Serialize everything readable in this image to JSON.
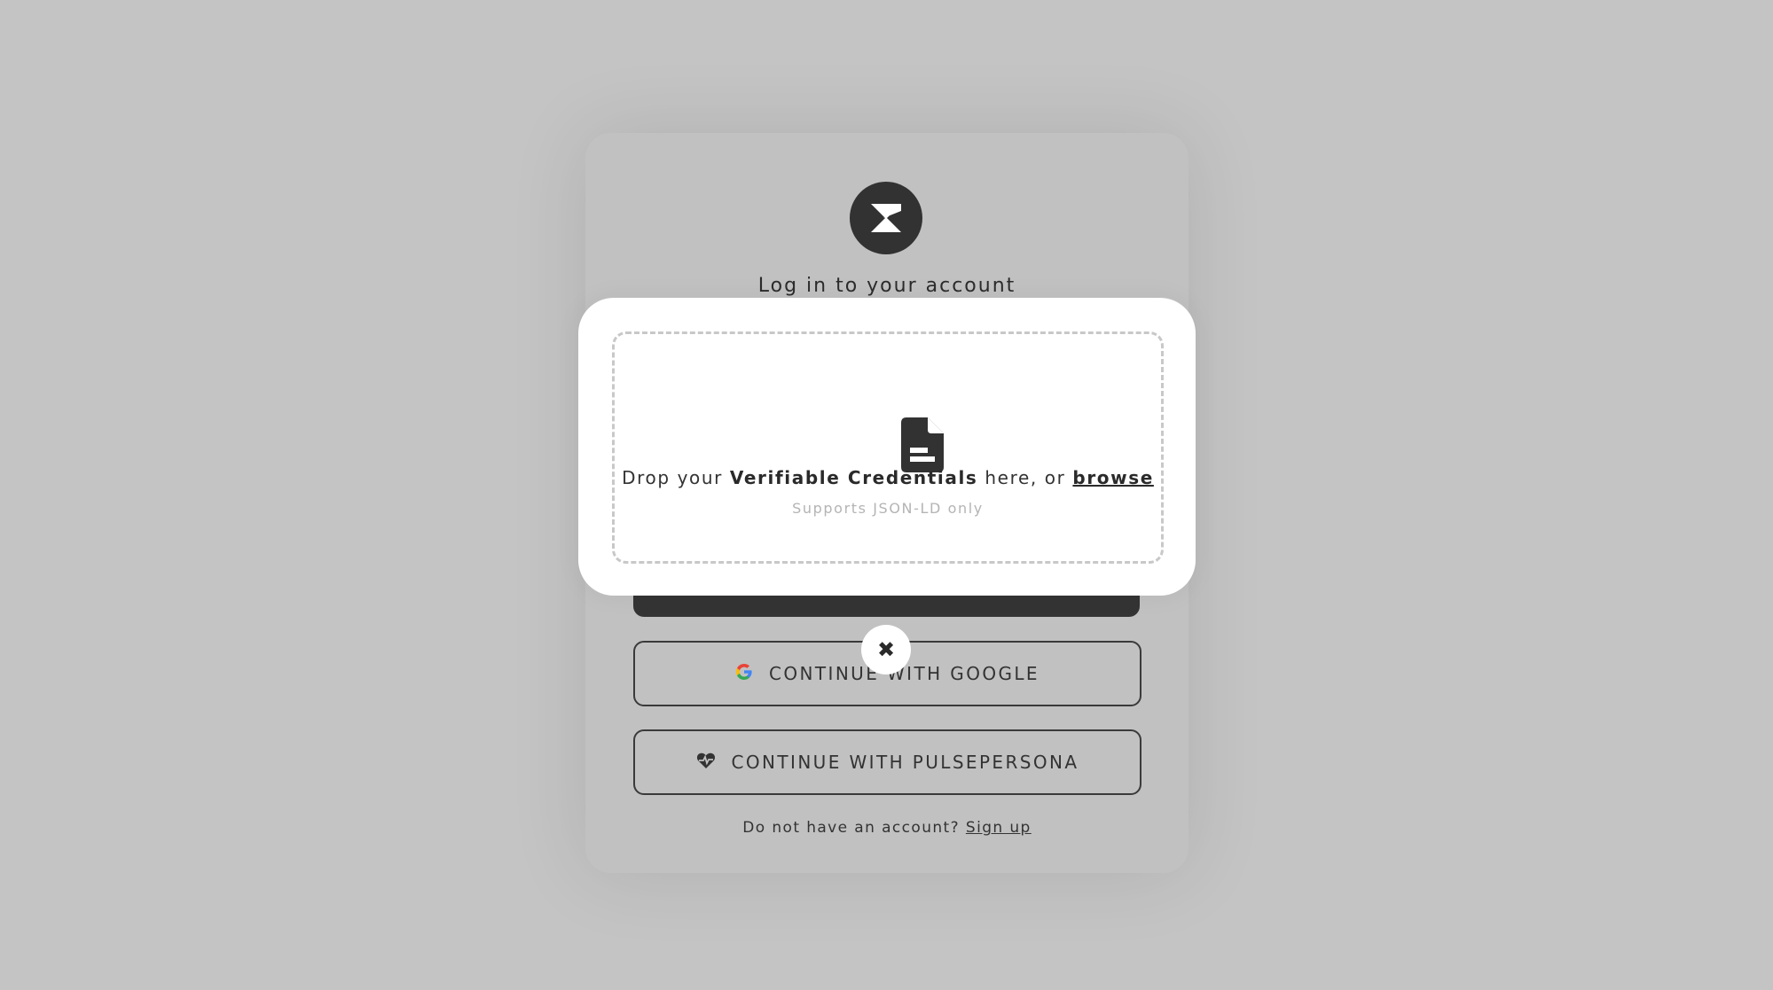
{
  "login": {
    "title": "Log in to your account",
    "google_label": "CONTINUE WITH GOOGLE",
    "pulse_label": "CONTINUE WITH PULSEPERSONA",
    "signup_prompt": "Do not have an account?",
    "signup_link": "Sign up"
  },
  "modal": {
    "drop_prefix": "Drop your",
    "drop_strong": "Verifiable Credentials",
    "drop_middle": "here, or",
    "browse_label": "browse",
    "hint": "Supports JSON-LD only",
    "close_glyph": "✖"
  },
  "icons": {
    "logo": "logo-icon",
    "document": "file-document-icon",
    "google": "google-icon",
    "pulsepersona": "heart-pulse-icon",
    "close": "close-icon"
  },
  "colors": {
    "overlay_bg": "#c4c4c4",
    "dark": "#333333",
    "hint": "#b4b4b4",
    "dropzone_border": "#c8c8c8"
  }
}
